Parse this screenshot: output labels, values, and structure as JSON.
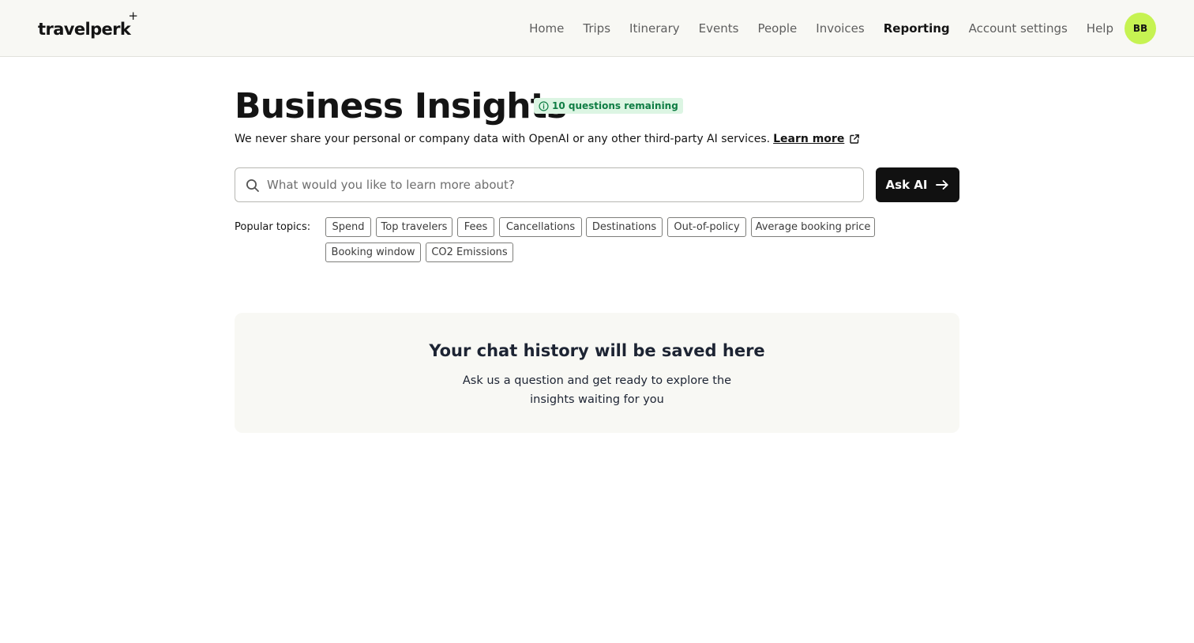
{
  "brand": {
    "logo_text": "travelperk",
    "logo_mark": "+"
  },
  "nav": {
    "items": [
      {
        "label": "Home"
      },
      {
        "label": "Trips"
      },
      {
        "label": "Itinerary"
      },
      {
        "label": "Events"
      },
      {
        "label": "People"
      },
      {
        "label": "Invoices"
      },
      {
        "label": "Reporting",
        "active": true
      },
      {
        "label": "Account settings"
      },
      {
        "label": "Help"
      }
    ],
    "avatar_initials": "BB",
    "avatar_color": "#c6f352"
  },
  "page": {
    "title": "Business Insights",
    "badge": "10 questions remaining",
    "badge_icon": "info-icon",
    "disclaimer": "We never share your personal or company data with OpenAI or any other third-party AI services.",
    "learn_more": "Learn more",
    "learn_more_icon": "external-link-icon"
  },
  "search": {
    "placeholder": "What would you like to learn more about?",
    "value": "",
    "icon": "search-icon",
    "button_label": "Ask AI",
    "button_icon": "arrow-right-icon"
  },
  "topics": {
    "label": "Popular topics:",
    "items": [
      "Spend",
      "Top travelers",
      "Fees",
      "Cancellations",
      "Destinations",
      "Out-of-policy",
      "Average booking price",
      "Booking window",
      "CO2 Emissions"
    ]
  },
  "history": {
    "title": "Your chat history will be saved here",
    "text": "Ask us a question and get ready to explore the insights waiting for you"
  },
  "colors": {
    "header_bg": "#f8f8f4",
    "badge_bg": "#dcf5e3",
    "badge_text": "#0f7d44",
    "button_bg": "#111111",
    "panel_bg": "#f8f8f4"
  }
}
